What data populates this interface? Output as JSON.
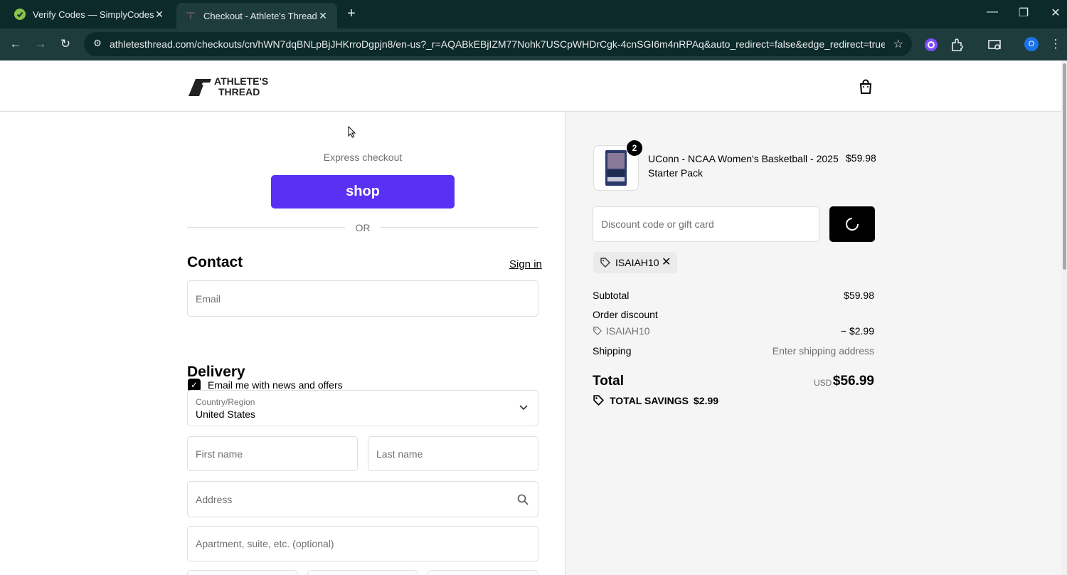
{
  "browser": {
    "tabs": [
      {
        "title": "Verify Codes — SimplyCodes",
        "active": false
      },
      {
        "title": "Checkout - Athlete's Thread",
        "active": true
      }
    ],
    "url": "athletesthread.com/checkouts/cn/hWN7dqBNLpBjJHKrroDgpjn8/en-us?_r=AQABkEBjIZM77Nohk7USCpWHDrCgk-4cnSGI6m4nRPAq&auto_redirect=false&edge_redirect=true&s...",
    "profile_initial": "O"
  },
  "header": {
    "logo_text_line1": "ATHLETE'S",
    "logo_text_line2": "THREAD"
  },
  "left": {
    "express_label": "Express checkout",
    "shop_button": "shop",
    "or_text": "OR",
    "contact_heading": "Contact",
    "signin_link": "Sign in",
    "email_placeholder": "Email",
    "newsletter_label": "Email me with news and offers",
    "newsletter_checked": true,
    "delivery_heading": "Delivery",
    "country_label": "Country/Region",
    "country_value": "United States",
    "first_name_placeholder": "First name",
    "last_name_placeholder": "Last name",
    "address_placeholder": "Address",
    "apartment_placeholder": "Apartment, suite, etc. (optional)"
  },
  "summary": {
    "product_name": "UConn - NCAA Women's Basketball - 2025 Starter Pack",
    "product_price": "$59.98",
    "quantity": "2",
    "discount_placeholder": "Discount code or gift card",
    "applied_code": "ISAIAH10",
    "subtotal_label": "Subtotal",
    "subtotal_value": "$59.98",
    "order_discount_label": "Order discount",
    "discount_code": "ISAIAH10",
    "discount_value": "− $2.99",
    "shipping_label": "Shipping",
    "shipping_value": "Enter shipping address",
    "total_label": "Total",
    "currency": "USD",
    "total_value": "$56.99",
    "savings_label": "TOTAL SAVINGS",
    "savings_value": "$2.99"
  },
  "colors": {
    "shop_purple": "#5a31f4",
    "chrome_dark": "#0d2a2a",
    "chrome_toolbar": "#1e3c3c"
  }
}
